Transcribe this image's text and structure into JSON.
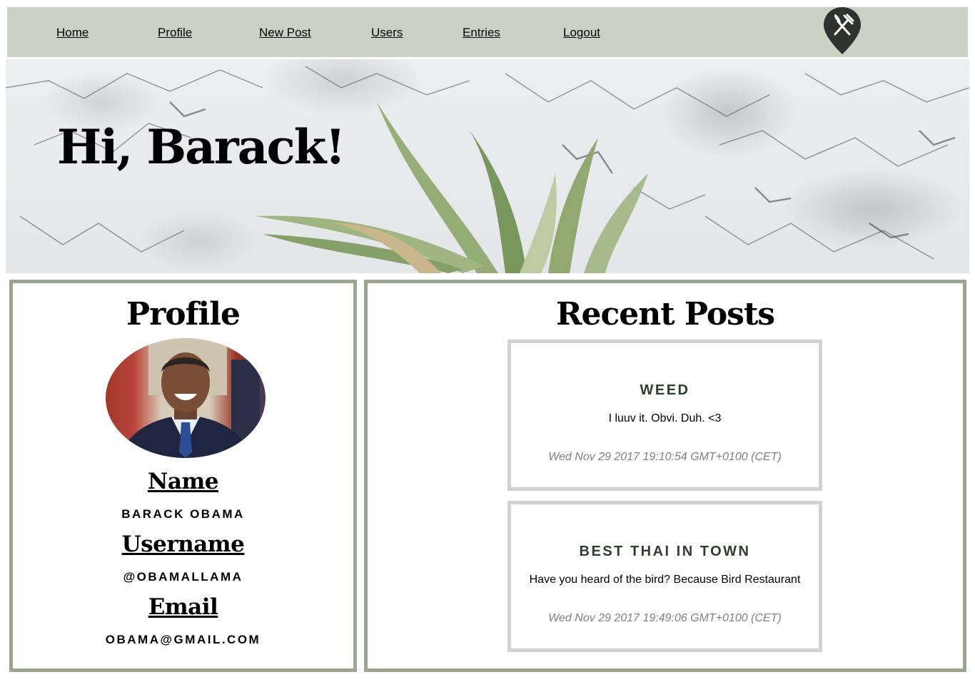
{
  "nav": {
    "items": [
      {
        "label": "Home"
      },
      {
        "label": "Profile"
      },
      {
        "label": "New Post"
      },
      {
        "label": "Users"
      },
      {
        "label": "Entries"
      },
      {
        "label": "Logout"
      }
    ],
    "logo_icon": "fork-knife-pin-icon"
  },
  "hero": {
    "greeting": "Hi, Barack!"
  },
  "profile": {
    "heading": "Profile",
    "name_label": "Name",
    "name_value": "BARACK OBAMA",
    "username_label": "Username",
    "username_value": "@OBAMALLAMA",
    "email_label": "Email",
    "email_value": "OBAMA@GMAIL.COM"
  },
  "posts": {
    "heading": "Recent Posts",
    "items": [
      {
        "title": "WEED",
        "body": "I luuv it. Obvi. Duh. <3",
        "date": "Wed Nov 29 2017 19:10:54 GMT+0100 (CET)"
      },
      {
        "title": "BEST THAI IN TOWN",
        "body": "Have you heard of the bird? Because Bird Restaurant",
        "date": "Wed Nov 29 2017 19:49:06 GMT+0100 (CET)"
      }
    ]
  },
  "colors": {
    "nav_bg": "#cbd1c3",
    "panel_border": "#9aa68d",
    "post_border": "#d2d2d2",
    "post_title": "#2e3e2c",
    "post_date": "#808080"
  }
}
